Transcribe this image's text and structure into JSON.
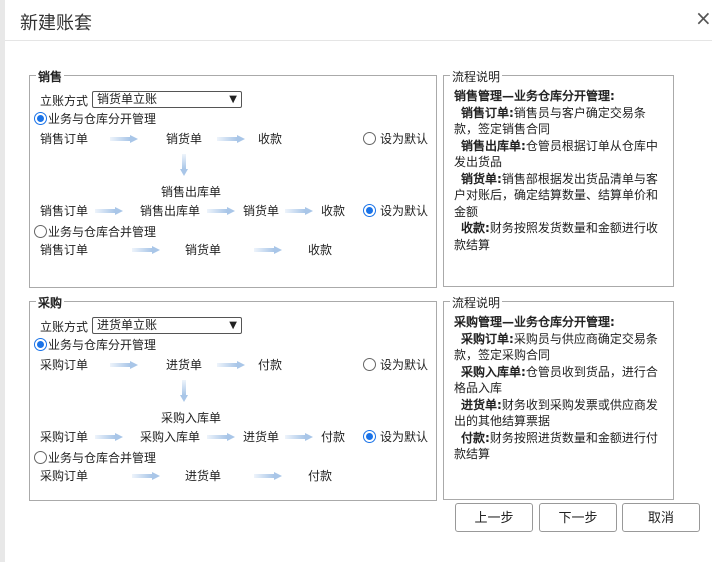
{
  "dialog": {
    "title": "新建账套",
    "close_icon": "×"
  },
  "sales": {
    "legend": "销售",
    "mode_label": "立账方式",
    "mode_value": "销货单立账",
    "opt_separate": "业务与仓库分开管理",
    "opt_merged": "业务与仓库合并管理",
    "set_default": "设为默认",
    "flow1": [
      "销售订单",
      "销货单",
      "收款"
    ],
    "flow_mid": "销售出库单",
    "flow2": [
      "销售订单",
      "销售出库单",
      "销货单",
      "收款"
    ],
    "flow3": [
      "销售订单",
      "销货单",
      "收款"
    ],
    "default1_checked": false,
    "default2_checked": true,
    "separate_checked": true,
    "merged_checked": false
  },
  "sales_desc": {
    "legend": "流程说明",
    "heading": "销售管理—业务仓库分开管理:",
    "items": [
      {
        "k": "销售订单:",
        "v": "销售员与客户确定交易条款，签定销售合同"
      },
      {
        "k": "销售出库单:",
        "v": "仓管员根据订单从仓库中发出货品"
      },
      {
        "k": "销货单:",
        "v": "销售部根据发出货品清单与客户对账后，确定结算数量、结算单价和金额"
      },
      {
        "k": "收款:",
        "v": "财务按照发货数量和金额进行收款结算"
      }
    ]
  },
  "purchase": {
    "legend": "采购",
    "mode_label": "立账方式",
    "mode_value": "进货单立账",
    "opt_separate": "业务与仓库分开管理",
    "opt_merged": "业务与仓库合并管理",
    "set_default": "设为默认",
    "flow1": [
      "采购订单",
      "进货单",
      "付款"
    ],
    "flow_mid": "采购入库单",
    "flow2": [
      "采购订单",
      "采购入库单",
      "进货单",
      "付款"
    ],
    "flow3": [
      "采购订单",
      "进货单",
      "付款"
    ]
  },
  "purchase_desc": {
    "legend": "流程说明",
    "heading": "采购管理—业务仓库分开管理:",
    "items": [
      {
        "k": "采购订单:",
        "v": "采购员与供应商确定交易条款，签定采购合同"
      },
      {
        "k": "采购入库单:",
        "v": "仓管员收到货品，进行合格品入库"
      },
      {
        "k": "进货单:",
        "v": "财务收到采购发票或供应商发出的其他结算票据"
      },
      {
        "k": "付款:",
        "v": "财务按照进货数量和金额进行付款结算"
      }
    ]
  },
  "buttons": {
    "prev": "上一步",
    "next": "下一步",
    "cancel": "取消"
  }
}
